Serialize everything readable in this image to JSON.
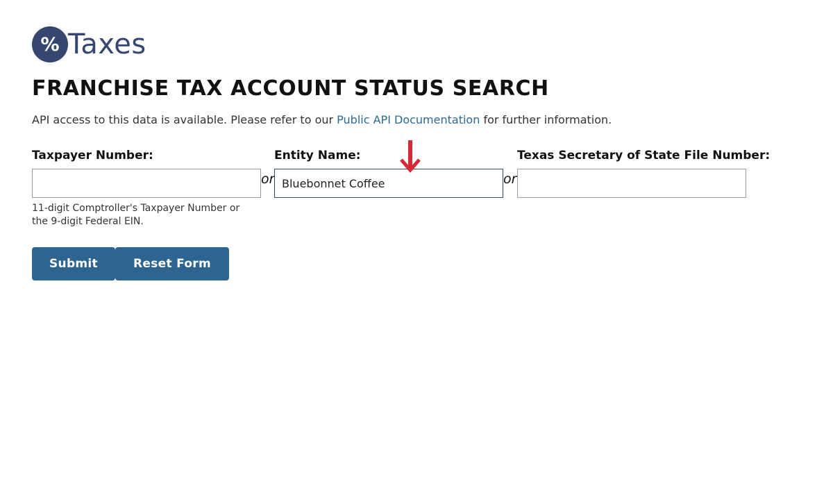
{
  "logo": {
    "symbol": "%",
    "text": "Taxes",
    "color": "#35466f"
  },
  "page": {
    "title": "FRANCHISE TAX ACCOUNT STATUS SEARCH",
    "api_note_prefix": "API access to this data is available. Please refer to our ",
    "api_link_text": "Public API Documentation",
    "api_note_suffix": " for further information."
  },
  "form": {
    "taxpayer_label": "Taxpayer Number:",
    "taxpayer_value": "",
    "taxpayer_hint": "11-digit Comptroller's Taxpayer Number or the 9-digit Federal EIN.",
    "or_1": "or",
    "entity_label": "Entity Name:",
    "entity_value": "Bluebonnet Coffee",
    "or_2": "or",
    "sos_label": "Texas Secretary of State File Number:",
    "sos_value": "",
    "submit_label": "Submit",
    "reset_label": "Reset Form"
  },
  "annotation": {
    "icon": "arrow-down-icon",
    "color": "#d42a35"
  },
  "colors": {
    "button": "#2e6490",
    "link": "#2b6a94"
  }
}
